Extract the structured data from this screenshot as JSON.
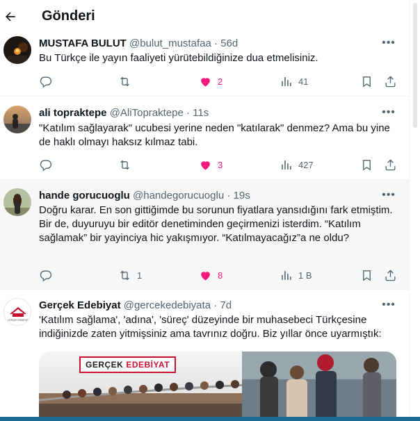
{
  "header": {
    "title": "Gönderi",
    "back_icon": "arrow-left-icon"
  },
  "colors": {
    "like": "#f91880",
    "muted": "#536471",
    "text": "#0f1419",
    "accent": "#1d9bf0",
    "logo_red": "#c8102e"
  },
  "tweets": [
    {
      "name": "MUSTAFA BULUT",
      "handle": "@bulut_mustafaa",
      "dot": "·",
      "time": "56d",
      "text": "Bu Türkçe ile yayın faaliyeti yürütebildiğinize dua etmelisiniz.",
      "replies": "",
      "retweets": "",
      "likes": "2",
      "views": "41",
      "liked": true
    },
    {
      "name": "ali topraktepe",
      "handle": "@AliTopraktepe",
      "dot": "·",
      "time": "11s",
      "text": "\"Katılım sağlayarak\" ucubesi yerine neden  \"katılarak\" denmez? Ama bu yine de haklı olmayı haksız kılmaz tabi.",
      "replies": "",
      "retweets": "",
      "likes": "3",
      "views": "427",
      "liked": true
    },
    {
      "name": "hande gorucuoglu",
      "handle": "@handegorucuoglu",
      "dot": "·",
      "time": "19s",
      "text": "Doğru karar. En son gittiğimde bu sorunun fiyatlara yansıdığını fark etmiştim. Bir de, duyuruyu bir editör denetiminden geçirmenizi isterdim. “Katılım sağlamak” bir yayinciya hic yakışmıyor. “Katılmayacağız”a ne oldu?",
      "replies": "",
      "retweets": "1",
      "likes": "8",
      "views": "1 B",
      "liked": true
    },
    {
      "name": "Gerçek Edebiyat",
      "handle": "@gercekedebiyata",
      "dot": "·",
      "time": "7d",
      "text": "'Katılım sağlama', 'adına', 'süreç' düzeyinde bir muhasebeci Türkçesine indiğinizde zaten yitmişsiniz ama tavrınız doğru. Biz yıllar önce uyarmıştık:",
      "media_logo_a": "GERÇEK",
      "media_logo_b": "EDEBİYAT",
      "avatar_caption": "GERÇEK EDEBİYAT"
    }
  ],
  "icons": {
    "reply": "reply-icon",
    "retweet": "retweet-icon",
    "like": "heart-icon",
    "views": "views-icon",
    "bookmark": "bookmark-icon",
    "share": "share-icon",
    "more": "more-icon"
  }
}
